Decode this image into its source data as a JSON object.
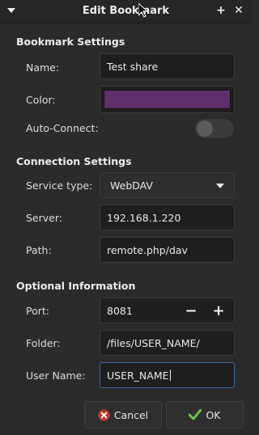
{
  "window": {
    "title": "Edit Bookmark",
    "menu_icon": "chevron-down-icon",
    "add_icon": "plus-icon",
    "close_icon": "close-icon"
  },
  "bookmark_settings": {
    "heading": "Bookmark Settings",
    "name_label": "Name:",
    "name_value": "Test share",
    "color_label": "Color:",
    "color_value": "#5f2f6b",
    "autoconnect_label": "Auto-Connect:",
    "autoconnect_on": false
  },
  "connection_settings": {
    "heading": "Connection Settings",
    "service_label": "Service type:",
    "service_value": "WebDAV",
    "server_label": "Server:",
    "server_value": "192.168.1.220",
    "path_label": "Path:",
    "path_value": "remote.php/dav"
  },
  "optional_information": {
    "heading": "Optional Information",
    "port_label": "Port:",
    "port_value": "8081",
    "folder_label": "Folder:",
    "folder_value": "/files/USER_NAME/",
    "username_label": "User Name:",
    "username_value": "USER_NAME"
  },
  "buttons": {
    "cancel_label": "Cancel",
    "ok_label": "OK"
  },
  "colors": {
    "background": "#2b2b2b",
    "field_bg": "#1f1f1f",
    "focus_border": "#3d6ea5",
    "cancel_icon": "#c0392b",
    "ok_icon": "#6cc04a"
  }
}
